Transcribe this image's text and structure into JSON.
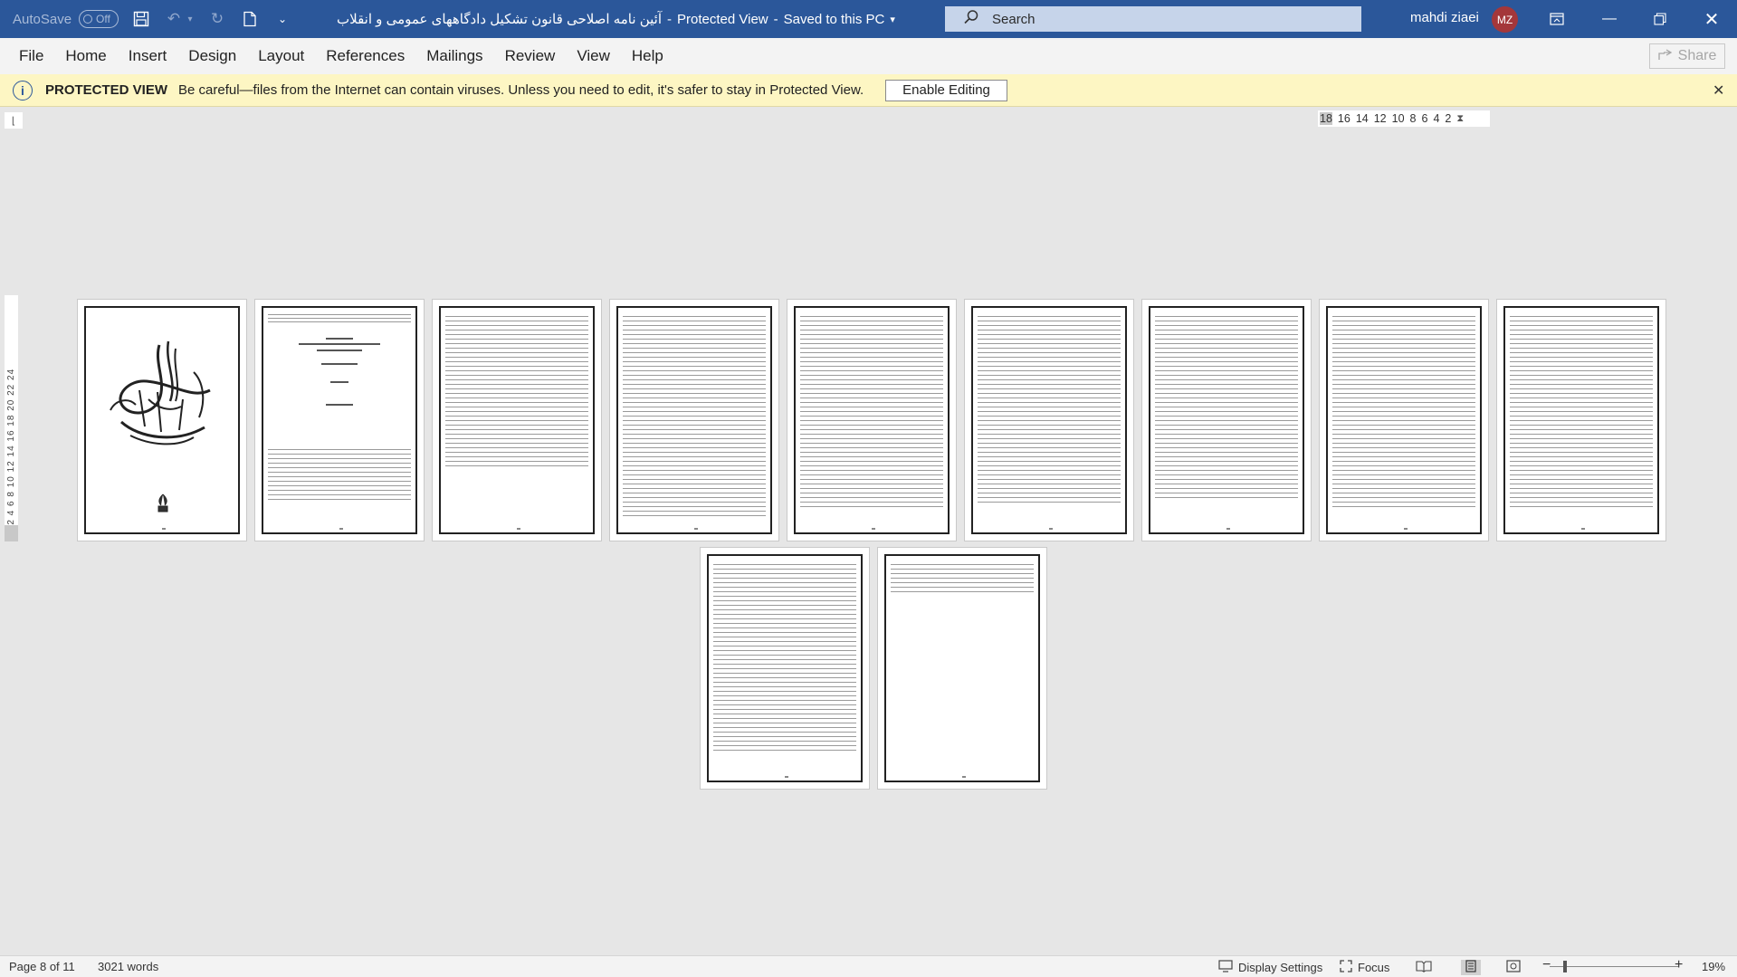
{
  "titlebar": {
    "autosave_label": "AutoSave",
    "autosave_state": "Off",
    "document_title": "آئین نامه اصلاحی قانون تشکیل دادگاههای عمومی و انقلاب",
    "separator1": "-",
    "view_mode": "Protected View",
    "separator2": "-",
    "save_state": "Saved to this PC",
    "search_placeholder": "Search",
    "user_name": "mahdi ziaei",
    "user_initials": "MZ",
    "accent_color": "#2b579a"
  },
  "menu": {
    "items": [
      "File",
      "Home",
      "Insert",
      "Design",
      "Layout",
      "References",
      "Mailings",
      "Review",
      "View",
      "Help"
    ],
    "share_label": "Share"
  },
  "protected_bar": {
    "title": "PROTECTED VIEW",
    "message": "Be careful—files from the Internet can contain viruses. Unless you need to edit, it's safer to stay in Protected View.",
    "button_label": "Enable Editing",
    "close_glyph": "✕",
    "background_color": "#fdf6c3"
  },
  "ruler": {
    "horizontal_ticks": [
      "18",
      "16",
      "14",
      "12",
      "10",
      "8",
      "6",
      "4",
      "2"
    ],
    "vertical_ticks": "2  2  4  6  8  10  12  14  16  18  20  22  24"
  },
  "document": {
    "page_count": 11,
    "page_numbers": [
      "۱",
      "۲",
      "۳",
      "۴",
      "۵",
      "۶",
      "۷",
      "۸",
      "۹",
      "۱۰",
      "۱۱"
    ]
  },
  "status": {
    "page_info": "Page 8 of 11",
    "word_count": "3021 words",
    "display_settings": "Display Settings",
    "focus": "Focus",
    "zoom_minus": "−",
    "zoom_plus": "+",
    "zoom_level": "19%"
  }
}
